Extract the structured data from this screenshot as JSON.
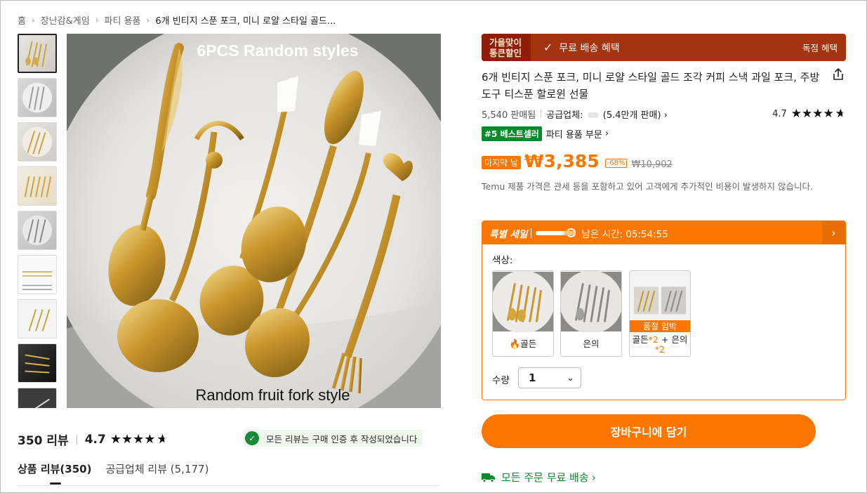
{
  "breadcrumb": [
    "홈",
    "장난감&게임",
    "파티 용품",
    "6개 빈티지 스푼 포크, 미니 로얄 스타일 골드..."
  ],
  "gallery": {
    "thumb_count": 9,
    "hero_caption_top": "6PCS Random styles",
    "hero_caption_bottom": "Random fruit fork style"
  },
  "reviews": {
    "count_label": "350 리뷰",
    "rating": "4.7",
    "verified_note": "모든 리뷰는 구매 인증 후 작성되었습니다",
    "tabs": [
      "상품 리뷰(350)",
      "공급업체 리뷰 (5,177)"
    ]
  },
  "promo": {
    "badge_line1": "가을맞이",
    "badge_line2": "통큰할인",
    "label": "무료 배송 혜택",
    "right": "독점 혜택",
    "bg_color": "#a3340f"
  },
  "product": {
    "title": "6개 빈티지 스푼 포크, 미니 로얄 스타일 골드 조각 커피 스낵 과일 포크, 주방 도구 티스푼 할로윈 선물",
    "sold": "5,540 판매됨",
    "seller_prefix": "공급업체:",
    "seller_sales": "(5.4만개 판매)",
    "rating": "4.7",
    "bestseller_badge": "#5 베스트셀러",
    "bestseller_category": "파티 용품 부문",
    "last_day": "마지막 날",
    "price": "₩3,385",
    "discount": "-68%",
    "old_price": "₩10,902",
    "tax_note": "Temu 제품 가격은 관세 등을 포함하고 있어 고객에게 추가적인 비용이 발생하지 않습니다."
  },
  "special_sale": {
    "label": "특별 세일",
    "time_left": "남은 시간: 05:54:55",
    "progress": 0.72,
    "color_label": "색상:",
    "options": [
      {
        "label": "골든",
        "hot": true
      },
      {
        "label": "은의",
        "hot": false
      },
      {
        "label_a": "골든",
        "mul_a": "*2",
        "plus": "+",
        "label_b": "은의",
        "mul_b": "*2",
        "sold_out_soon": "품절 임박"
      }
    ],
    "qty_label": "수량",
    "qty_value": "1"
  },
  "cart_button": "장바구니에 담기",
  "shipping": "모든 주문 무료 배송",
  "accent_color": "#fb7701",
  "green_color": "#0a8a2c"
}
